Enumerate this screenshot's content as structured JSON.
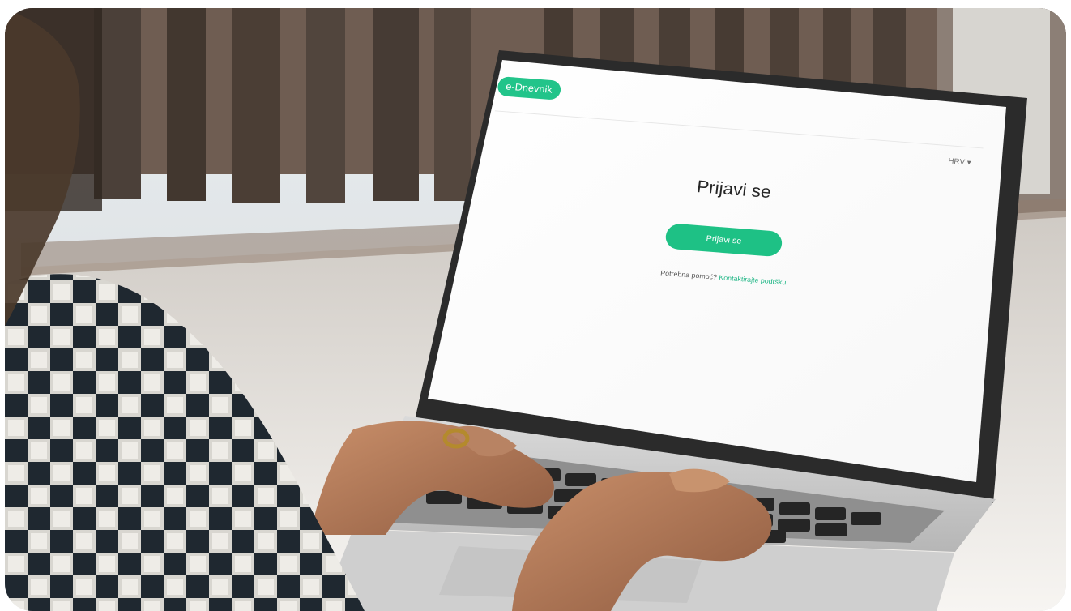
{
  "app": {
    "logo_text": "e-Dnevnik"
  },
  "header": {
    "language_label": "HRV ▾"
  },
  "login": {
    "title": "Prijavi se",
    "button_label": "Prijavi se",
    "help_prefix": "Potrebna pomoć?",
    "help_link": "Kontaktirajte podršku"
  },
  "colors": {
    "accent": "#22c48a",
    "accent_dark": "#1ec185",
    "text": "#252525"
  },
  "icons": {
    "logo": "leaf-icon"
  }
}
